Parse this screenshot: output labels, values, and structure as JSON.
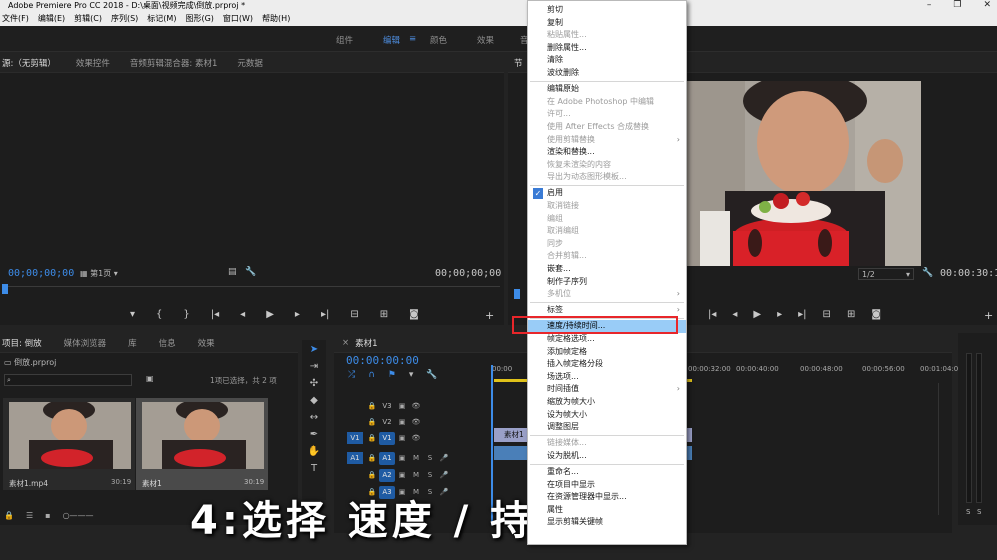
{
  "window": {
    "title": "Adobe Premiere Pro CC 2018 - D:\\桌面\\视频完成\\倒放.prproj *",
    "controls": [
      "–",
      "❐",
      "✕"
    ]
  },
  "menu": [
    "文件(F)",
    "编辑(E)",
    "剪辑(C)",
    "序列(S)",
    "标记(M)",
    "图形(G)",
    "窗口(W)",
    "帮助(H)"
  ],
  "workspaces": {
    "items": [
      "组件",
      "编辑",
      "颜色",
      "效果",
      "音"
    ],
    "active": "编辑"
  },
  "source_panel": {
    "tabs": [
      "源:（无剪辑）",
      "效果控件",
      "音频剪辑混合器: 素材1",
      "元数据"
    ],
    "timecode_left": "00;00;00;00",
    "page": "第1页",
    "timecode_right": "00;00;00;00"
  },
  "program_panel": {
    "tab": "节",
    "zoom": "1/2",
    "timecode_right": "00:00:30:19"
  },
  "project_panel": {
    "tabs": [
      "项目: 倒放",
      "媒体浏览器",
      "库",
      "信息",
      "效果"
    ],
    "file": "倒放.prproj",
    "search_placeholder": "",
    "selection_status": "1项已选择，共 2 项",
    "items": [
      {
        "name": "素材1.mp4",
        "duration": "30:19"
      },
      {
        "name": "素材1",
        "duration": "30:19"
      }
    ]
  },
  "timeline": {
    "tab": "素材1",
    "timecode": "00:00:00:00",
    "ruler": [
      "00:00",
      "00:00:32:00",
      "00:00:40:00",
      "00:00:48:00",
      "00:00:56:00",
      "00:01:04:00"
    ],
    "video_tracks": [
      "V3",
      "V2",
      "V1"
    ],
    "audio_tracks": [
      "A1",
      "A2",
      "A3"
    ],
    "clip_label": "素材1",
    "track_buttons": {
      "m": "M",
      "s": "S"
    }
  },
  "meter": {
    "labels": [
      "S",
      "S"
    ]
  },
  "context_menu": {
    "items": [
      {
        "label": "剪切",
        "enabled": true
      },
      {
        "label": "复制",
        "enabled": true
      },
      {
        "label": "粘贴属性...",
        "enabled": false
      },
      {
        "label": "删除属性...",
        "enabled": true
      },
      {
        "label": "清除",
        "enabled": true
      },
      {
        "label": "波纹删除",
        "enabled": true
      },
      {
        "sep": true
      },
      {
        "label": "编辑原始",
        "enabled": true
      },
      {
        "label": "在 Adobe Photoshop 中编辑",
        "enabled": false
      },
      {
        "label": "许可...",
        "enabled": false
      },
      {
        "label": "使用 After Effects 合成替换",
        "enabled": false
      },
      {
        "label": "使用剪辑替换",
        "enabled": false,
        "submenu": true
      },
      {
        "label": "渲染和替换...",
        "enabled": true
      },
      {
        "label": "恢复未渲染的内容",
        "enabled": false
      },
      {
        "label": "导出为动态图形模板...",
        "enabled": false
      },
      {
        "sep": true
      },
      {
        "label": "启用",
        "enabled": true,
        "checked": true
      },
      {
        "label": "取消链接",
        "enabled": false
      },
      {
        "label": "编组",
        "enabled": false
      },
      {
        "label": "取消编组",
        "enabled": false
      },
      {
        "label": "同步",
        "enabled": false
      },
      {
        "label": "合并剪辑...",
        "enabled": false
      },
      {
        "label": "嵌套...",
        "enabled": true
      },
      {
        "label": "制作子序列",
        "enabled": true
      },
      {
        "label": "多机位",
        "enabled": false,
        "submenu": true
      },
      {
        "sep": true
      },
      {
        "label": "标签",
        "enabled": true,
        "submenu": true
      },
      {
        "sep": true
      },
      {
        "label": "速度/持续时间...",
        "enabled": true,
        "highlighted": true
      },
      {
        "label": "帧定格选项...",
        "enabled": true
      },
      {
        "label": "添加帧定格",
        "enabled": true
      },
      {
        "label": "插入帧定格分段",
        "enabled": true
      },
      {
        "label": "场选项...",
        "enabled": true
      },
      {
        "label": "时间插值",
        "enabled": true,
        "submenu": true
      },
      {
        "label": "缩放为帧大小",
        "enabled": true
      },
      {
        "label": "设为帧大小",
        "enabled": true
      },
      {
        "label": "调整图层",
        "enabled": true
      },
      {
        "sep": true
      },
      {
        "label": "链接媒体...",
        "enabled": false
      },
      {
        "label": "设为脱机...",
        "enabled": true
      },
      {
        "sep": true
      },
      {
        "label": "重命名...",
        "enabled": true
      },
      {
        "label": "在项目中显示",
        "enabled": true
      },
      {
        "label": "在资源管理器中显示...",
        "enabled": true
      },
      {
        "label": "属性",
        "enabled": true
      },
      {
        "label": "显示剪辑关键帧",
        "enabled": true
      }
    ]
  },
  "caption": "4:选择 速度 / 持续时间",
  "colors": {
    "accent": "#3d8ce8",
    "highlight_box": "#e8262a",
    "menu_highlight": "#99ccf7"
  }
}
